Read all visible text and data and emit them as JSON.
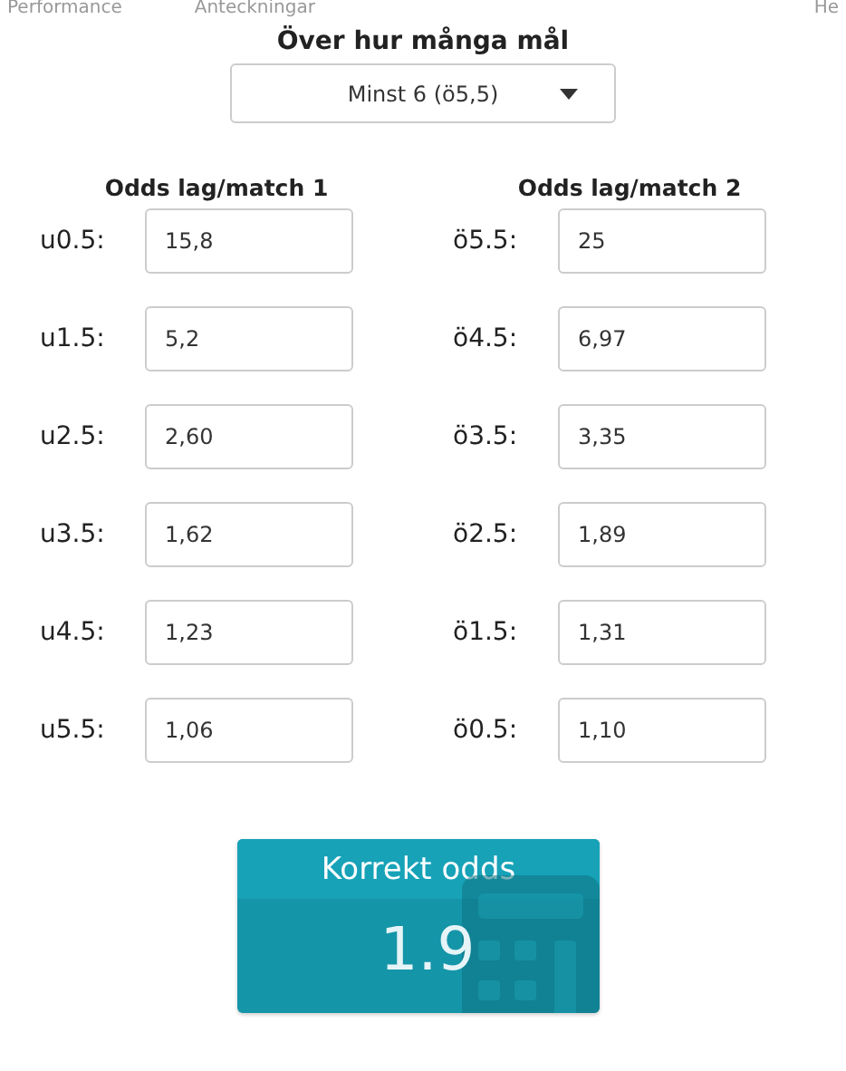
{
  "nav": [
    "Performance",
    "Anteckningar",
    "He"
  ],
  "goals": {
    "label": "Över hur många mål",
    "value": "Minst 6 (ö5,5)"
  },
  "columns": [
    {
      "title": "Odds lag/match 1",
      "rows": [
        {
          "label": "u0.5:",
          "value": "15,8"
        },
        {
          "label": "u1.5:",
          "value": "5,2"
        },
        {
          "label": "u2.5:",
          "value": "2,60"
        },
        {
          "label": "u3.5:",
          "value": "1,62"
        },
        {
          "label": "u4.5:",
          "value": "1,23"
        },
        {
          "label": "u5.5:",
          "value": "1,06"
        }
      ]
    },
    {
      "title": "Odds lag/match 2",
      "rows": [
        {
          "label": "ö5.5:",
          "value": "25"
        },
        {
          "label": "ö4.5:",
          "value": "6,97"
        },
        {
          "label": "ö3.5:",
          "value": "3,35"
        },
        {
          "label": "ö2.5:",
          "value": "1,89"
        },
        {
          "label": "ö1.5:",
          "value": "1,31"
        },
        {
          "label": "ö0.5:",
          "value": "1,10"
        }
      ]
    }
  ],
  "result": {
    "title": "Korrekt odds",
    "value": "1.9"
  }
}
